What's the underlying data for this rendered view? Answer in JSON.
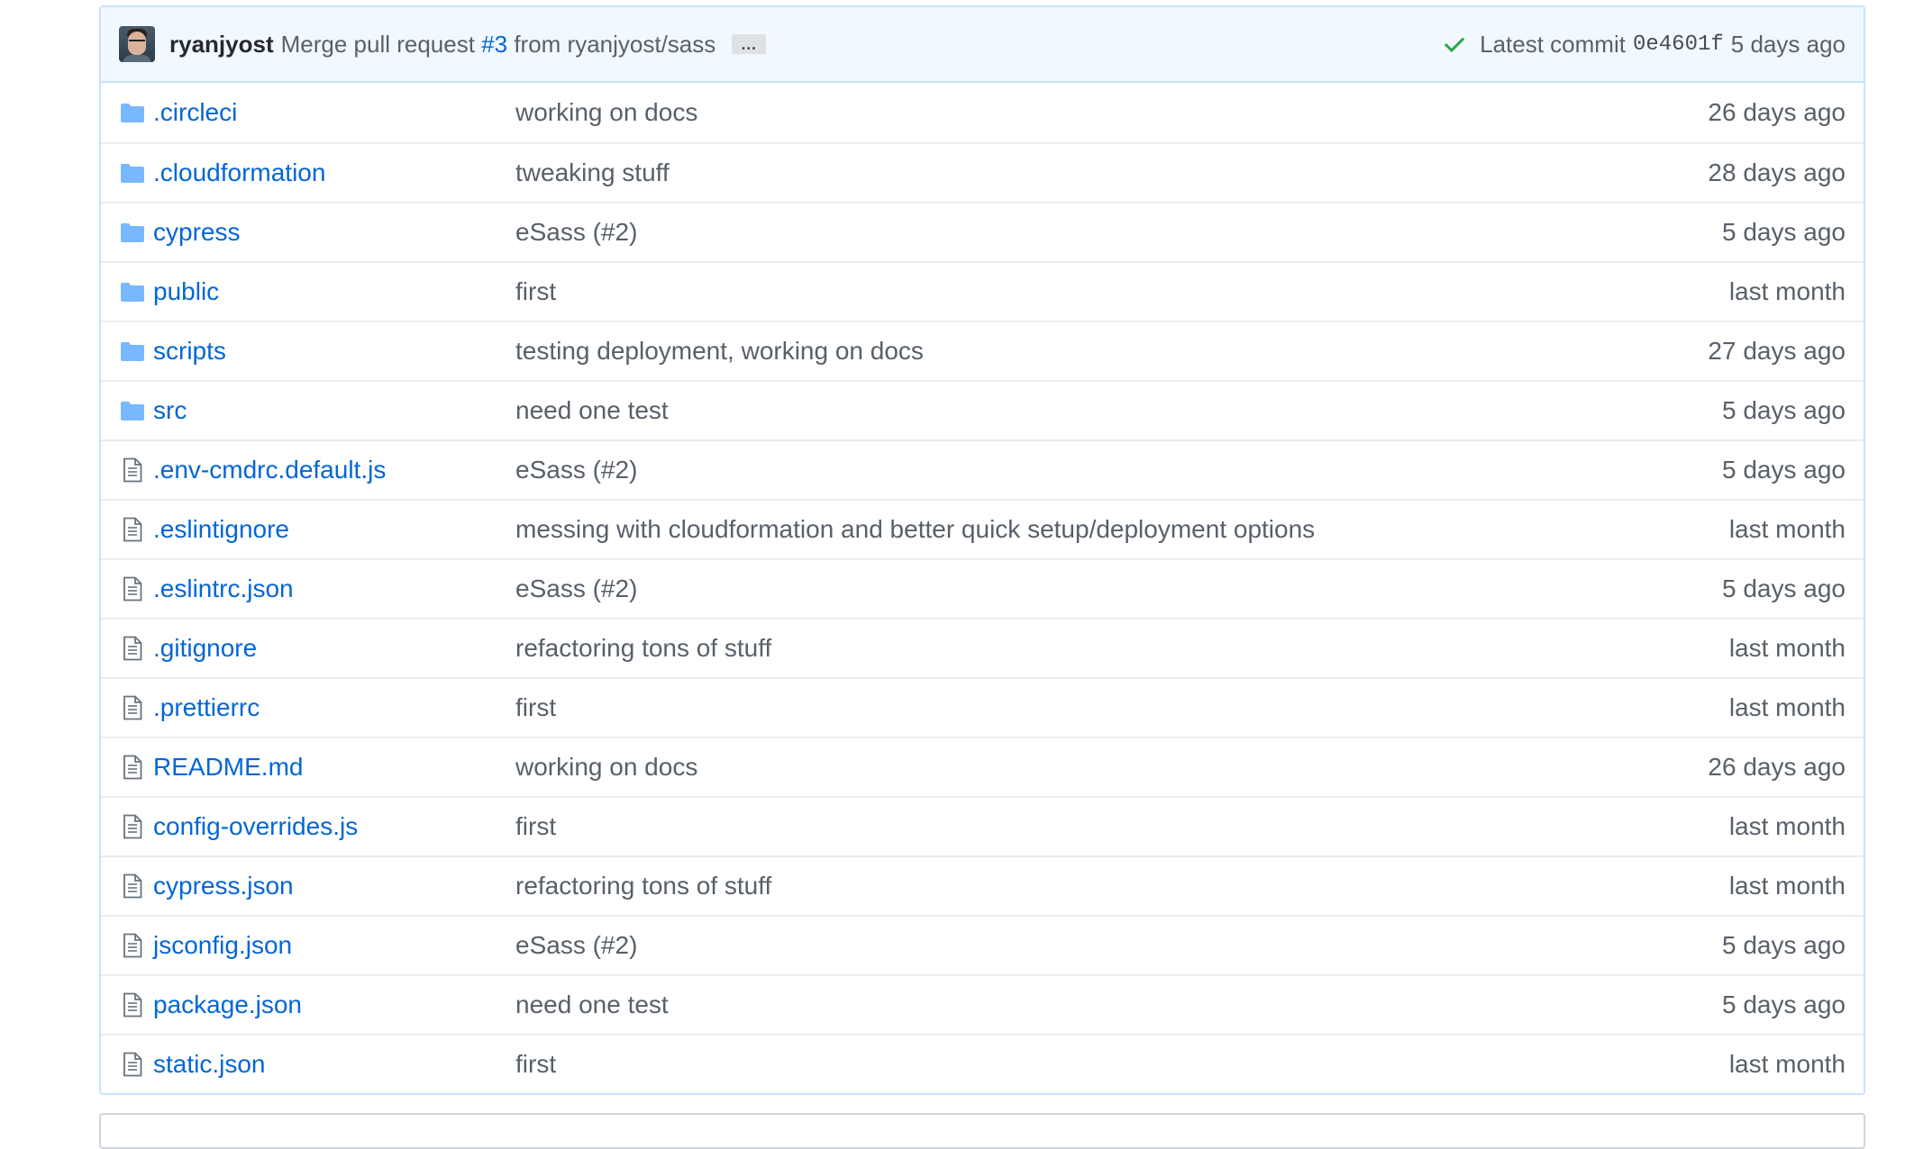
{
  "commit": {
    "author": "ryanjyost",
    "message_prefix": "Merge pull request ",
    "pr_link": "#3",
    "message_suffix": " from ryanjyost/sass",
    "ellipsis": "…",
    "latest_label": "Latest commit",
    "sha": "0e4601f",
    "age": "5 days ago",
    "status_color": "#28a745"
  },
  "files": [
    {
      "type": "folder",
      "icon": "folder-icon",
      "name": ".circleci",
      "message": "working on docs",
      "age": "26 days ago"
    },
    {
      "type": "folder",
      "icon": "folder-icon",
      "name": ".cloudformation",
      "message": "tweaking stuff",
      "age": "28 days ago"
    },
    {
      "type": "folder",
      "icon": "folder-icon",
      "name": "cypress",
      "message": "eSass (#2)",
      "age": "5 days ago"
    },
    {
      "type": "folder",
      "icon": "folder-icon",
      "name": "public",
      "message": "first",
      "age": "last month"
    },
    {
      "type": "folder",
      "icon": "folder-icon",
      "name": "scripts",
      "message": "testing deployment, working on docs",
      "age": "27 days ago"
    },
    {
      "type": "folder",
      "icon": "folder-icon",
      "name": "src",
      "message": "need one test",
      "age": "5 days ago"
    },
    {
      "type": "file",
      "icon": "file-icon",
      "name": ".env-cmdrc.default.js",
      "message": "eSass (#2)",
      "age": "5 days ago"
    },
    {
      "type": "file",
      "icon": "file-icon",
      "name": ".eslintignore",
      "message": "messing with cloudformation and better quick setup/deployment options",
      "age": "last month"
    },
    {
      "type": "file",
      "icon": "file-icon",
      "name": ".eslintrc.json",
      "message": "eSass (#2)",
      "age": "5 days ago"
    },
    {
      "type": "file",
      "icon": "file-icon",
      "name": ".gitignore",
      "message": "refactoring tons of stuff",
      "age": "last month"
    },
    {
      "type": "file",
      "icon": "file-icon",
      "name": ".prettierrc",
      "message": "first",
      "age": "last month"
    },
    {
      "type": "file",
      "icon": "file-icon",
      "name": "README.md",
      "message": "working on docs",
      "age": "26 days ago"
    },
    {
      "type": "file",
      "icon": "file-icon",
      "name": "config-overrides.js",
      "message": "first",
      "age": "last month"
    },
    {
      "type": "file",
      "icon": "file-icon",
      "name": "cypress.json",
      "message": "refactoring tons of stuff",
      "age": "last month"
    },
    {
      "type": "file",
      "icon": "file-icon",
      "name": "jsconfig.json",
      "message": "eSass (#2)",
      "age": "5 days ago"
    },
    {
      "type": "file",
      "icon": "file-icon",
      "name": "package.json",
      "message": "need one test",
      "age": "5 days ago"
    },
    {
      "type": "file",
      "icon": "file-icon",
      "name": "static.json",
      "message": "first",
      "age": "last month"
    }
  ],
  "colors": {
    "link": "#0366d6",
    "folder": "#79b8ff",
    "muted": "#586069",
    "header_bg": "#f1f8ff",
    "header_border": "#c8e1ff"
  }
}
